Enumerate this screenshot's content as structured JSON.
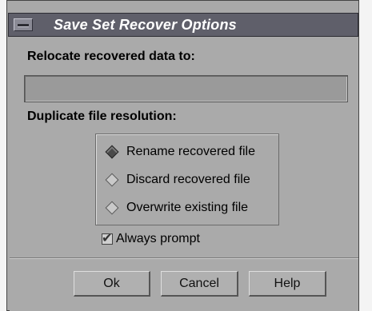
{
  "window": {
    "title": "Save Set Recover Options"
  },
  "relocate": {
    "heading": "Relocate recovered data to:",
    "value": ""
  },
  "duplicate": {
    "heading": "Duplicate file resolution:",
    "options": [
      "Rename recovered file",
      "Discard recovered file",
      "Overwrite existing file"
    ],
    "selected": "Rename recovered file"
  },
  "always_prompt": {
    "label": "Always prompt",
    "checked": true
  },
  "buttons": {
    "ok": "Ok",
    "cancel": "Cancel",
    "help": "Help"
  }
}
